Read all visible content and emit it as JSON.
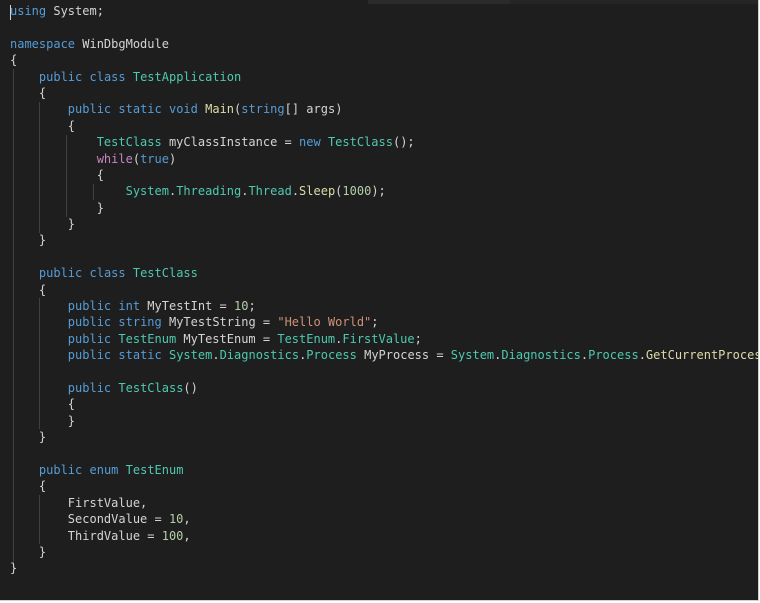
{
  "editor": {
    "language": "C#",
    "theme": "dark",
    "lines": [
      [
        {
          "t": "using",
          "c": "kw"
        },
        {
          "t": " System;",
          "c": "id"
        }
      ],
      [],
      [
        {
          "t": "namespace",
          "c": "kw"
        },
        {
          "t": " WinDbgModule",
          "c": "id"
        }
      ],
      [
        {
          "t": "{",
          "c": "id"
        }
      ],
      [
        {
          "t": "    ",
          "c": "id"
        },
        {
          "t": "public",
          "c": "kw"
        },
        {
          "t": " ",
          "c": "id"
        },
        {
          "t": "class",
          "c": "kw"
        },
        {
          "t": " ",
          "c": "id"
        },
        {
          "t": "TestApplication",
          "c": "ty"
        }
      ],
      [
        {
          "t": "    {",
          "c": "id"
        }
      ],
      [
        {
          "t": "        ",
          "c": "id"
        },
        {
          "t": "public",
          "c": "kw"
        },
        {
          "t": " ",
          "c": "id"
        },
        {
          "t": "static",
          "c": "kw"
        },
        {
          "t": " ",
          "c": "id"
        },
        {
          "t": "void",
          "c": "kw"
        },
        {
          "t": " ",
          "c": "id"
        },
        {
          "t": "Main",
          "c": "fn"
        },
        {
          "t": "(",
          "c": "id"
        },
        {
          "t": "string",
          "c": "kw"
        },
        {
          "t": "[] args)",
          "c": "id"
        }
      ],
      [
        {
          "t": "        {",
          "c": "id"
        }
      ],
      [
        {
          "t": "            ",
          "c": "id"
        },
        {
          "t": "TestClass",
          "c": "ty"
        },
        {
          "t": " myClassInstance = ",
          "c": "id"
        },
        {
          "t": "new",
          "c": "kw"
        },
        {
          "t": " ",
          "c": "id"
        },
        {
          "t": "TestClass",
          "c": "ty"
        },
        {
          "t": "();",
          "c": "id"
        }
      ],
      [
        {
          "t": "            ",
          "c": "id"
        },
        {
          "t": "while",
          "c": "ctl"
        },
        {
          "t": "(",
          "c": "id"
        },
        {
          "t": "true",
          "c": "kw"
        },
        {
          "t": ")",
          "c": "id"
        }
      ],
      [
        {
          "t": "            {",
          "c": "id"
        }
      ],
      [
        {
          "t": "                ",
          "c": "id"
        },
        {
          "t": "System",
          "c": "ty"
        },
        {
          "t": ".",
          "c": "id"
        },
        {
          "t": "Threading",
          "c": "ty"
        },
        {
          "t": ".",
          "c": "id"
        },
        {
          "t": "Thread",
          "c": "ty"
        },
        {
          "t": ".",
          "c": "id"
        },
        {
          "t": "Sleep",
          "c": "fn"
        },
        {
          "t": "(",
          "c": "id"
        },
        {
          "t": "1000",
          "c": "num"
        },
        {
          "t": ");",
          "c": "id"
        }
      ],
      [
        {
          "t": "            }",
          "c": "id"
        }
      ],
      [
        {
          "t": "        }",
          "c": "id"
        }
      ],
      [
        {
          "t": "    }",
          "c": "id"
        }
      ],
      [],
      [
        {
          "t": "    ",
          "c": "id"
        },
        {
          "t": "public",
          "c": "kw"
        },
        {
          "t": " ",
          "c": "id"
        },
        {
          "t": "class",
          "c": "kw"
        },
        {
          "t": " ",
          "c": "id"
        },
        {
          "t": "TestClass",
          "c": "ty"
        }
      ],
      [
        {
          "t": "    {",
          "c": "id"
        }
      ],
      [
        {
          "t": "        ",
          "c": "id"
        },
        {
          "t": "public",
          "c": "kw"
        },
        {
          "t": " ",
          "c": "id"
        },
        {
          "t": "int",
          "c": "kw"
        },
        {
          "t": " MyTestInt = ",
          "c": "id"
        },
        {
          "t": "10",
          "c": "num"
        },
        {
          "t": ";",
          "c": "id"
        }
      ],
      [
        {
          "t": "        ",
          "c": "id"
        },
        {
          "t": "public",
          "c": "kw"
        },
        {
          "t": " ",
          "c": "id"
        },
        {
          "t": "string",
          "c": "kw"
        },
        {
          "t": " MyTestString = ",
          "c": "id"
        },
        {
          "t": "\"Hello World\"",
          "c": "str"
        },
        {
          "t": ";",
          "c": "id"
        }
      ],
      [
        {
          "t": "        ",
          "c": "id"
        },
        {
          "t": "public",
          "c": "kw"
        },
        {
          "t": " ",
          "c": "id"
        },
        {
          "t": "TestEnum",
          "c": "ty"
        },
        {
          "t": " MyTestEnum = ",
          "c": "id"
        },
        {
          "t": "TestEnum",
          "c": "ty"
        },
        {
          "t": ".",
          "c": "id"
        },
        {
          "t": "FirstValue",
          "c": "ty"
        },
        {
          "t": ";",
          "c": "id"
        }
      ],
      [
        {
          "t": "        ",
          "c": "id"
        },
        {
          "t": "public",
          "c": "kw"
        },
        {
          "t": " ",
          "c": "id"
        },
        {
          "t": "static",
          "c": "kw"
        },
        {
          "t": " ",
          "c": "id"
        },
        {
          "t": "System",
          "c": "ty"
        },
        {
          "t": ".",
          "c": "id"
        },
        {
          "t": "Diagnostics",
          "c": "ty"
        },
        {
          "t": ".",
          "c": "id"
        },
        {
          "t": "Process",
          "c": "ty"
        },
        {
          "t": " MyProcess = ",
          "c": "id"
        },
        {
          "t": "System",
          "c": "ty"
        },
        {
          "t": ".",
          "c": "id"
        },
        {
          "t": "Diagnostics",
          "c": "ty"
        },
        {
          "t": ".",
          "c": "id"
        },
        {
          "t": "Process",
          "c": "ty"
        },
        {
          "t": ".",
          "c": "id"
        },
        {
          "t": "GetCurrentProcess",
          "c": "fn"
        },
        {
          "t": "();",
          "c": "id"
        }
      ],
      [],
      [
        {
          "t": "        ",
          "c": "id"
        },
        {
          "t": "public",
          "c": "kw"
        },
        {
          "t": " ",
          "c": "id"
        },
        {
          "t": "TestClass",
          "c": "ty"
        },
        {
          "t": "()",
          "c": "id"
        }
      ],
      [
        {
          "t": "        {",
          "c": "id"
        }
      ],
      [
        {
          "t": "        }",
          "c": "id"
        }
      ],
      [
        {
          "t": "    }",
          "c": "id"
        }
      ],
      [],
      [
        {
          "t": "    ",
          "c": "id"
        },
        {
          "t": "public",
          "c": "kw"
        },
        {
          "t": " ",
          "c": "id"
        },
        {
          "t": "enum",
          "c": "kw"
        },
        {
          "t": " ",
          "c": "id"
        },
        {
          "t": "TestEnum",
          "c": "ty"
        }
      ],
      [
        {
          "t": "    {",
          "c": "id"
        }
      ],
      [
        {
          "t": "        FirstValue,",
          "c": "id"
        }
      ],
      [
        {
          "t": "        SecondValue = ",
          "c": "id"
        },
        {
          "t": "10",
          "c": "num"
        },
        {
          "t": ",",
          "c": "id"
        }
      ],
      [
        {
          "t": "        ThirdValue = ",
          "c": "id"
        },
        {
          "t": "100",
          "c": "num"
        },
        {
          "t": ",",
          "c": "id"
        }
      ],
      [
        {
          "t": "    }",
          "c": "id"
        }
      ],
      [
        {
          "t": "}",
          "c": "id"
        }
      ]
    ]
  },
  "colors": {
    "background": "#1e1e1e",
    "keyword": "#569cd6",
    "type": "#4ec9b0",
    "function": "#dcdcaa",
    "string": "#ce9178",
    "number": "#b5cea8",
    "control": "#c586c0",
    "text": "#d4d4d4"
  }
}
